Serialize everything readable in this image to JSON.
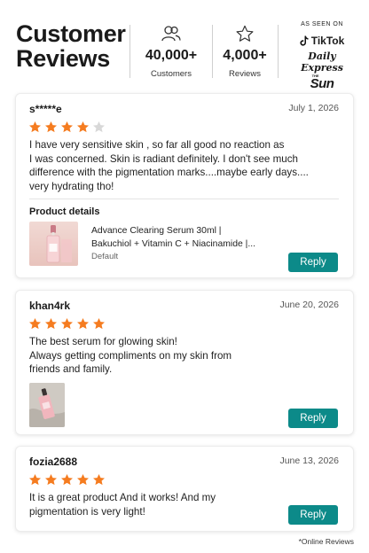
{
  "header": {
    "title_line1": "Customer",
    "title_line2": "Reviews",
    "stats": [
      {
        "icon": "users-icon",
        "value": "40,000+",
        "label": "Customers"
      },
      {
        "icon": "star-outline-icon",
        "value": "4,000+",
        "label": "Reviews"
      }
    ],
    "as_seen_on": {
      "label": "AS SEEN ON",
      "brands": [
        "TikTok",
        "Daily Express",
        "THE",
        "Sun"
      ]
    }
  },
  "colors": {
    "star_filled": "#f57c20",
    "star_empty": "#d8d8d8",
    "reply_button": "#0c8a89"
  },
  "reviews": [
    {
      "name": "s*****e",
      "date": "July 1, 2026",
      "rating": 4,
      "lines": [
        "I have very sensitive skin , so far all good no reaction as",
        "I was concerned. Skin is radiant definitely. I don't see much",
        "difference with the pigmentation marks....maybe early days....",
        "very hydrating tho!"
      ],
      "product_details": {
        "title": "Product details",
        "name_line1": "Advance Clearing Serum 30ml |",
        "name_line2": "Bakuchiol + Vitamin C + Niacinamide |...",
        "variant": "Default"
      },
      "reply_label": "Reply"
    },
    {
      "name": "khan4rk",
      "date": "June 20, 2026",
      "rating": 5,
      "lines": [
        "The best serum for glowing skin!",
        "Always getting compliments on my skin from",
        "friends and family."
      ],
      "reply_label": "Reply"
    },
    {
      "name": "fozia2688",
      "date": "June 13, 2026",
      "rating": 5,
      "lines": [
        "It is a great product And it works! And my",
        "pigmentation is very light!"
      ],
      "reply_label": "Reply"
    }
  ],
  "footnote": "*Online Reviews"
}
